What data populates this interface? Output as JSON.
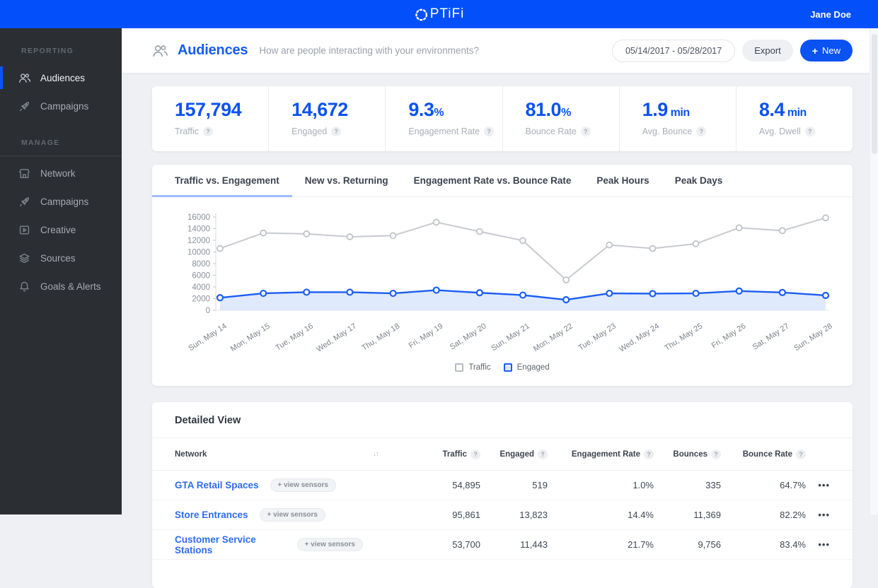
{
  "topbar": {
    "logo_text": "PTiFi",
    "user": "Jane Doe"
  },
  "sidebar": {
    "sections": [
      {
        "label": "REPORTING",
        "items": [
          {
            "label": "Audiences",
            "icon": "people-icon",
            "active": true
          },
          {
            "label": "Campaigns",
            "icon": "rocket-icon",
            "active": false
          }
        ]
      },
      {
        "label": "MANAGE",
        "items": [
          {
            "label": "Network",
            "icon": "storefront-icon",
            "active": false
          },
          {
            "label": "Campaigns",
            "icon": "rocket-icon",
            "active": false
          },
          {
            "label": "Creative",
            "icon": "media-icon",
            "active": false
          },
          {
            "label": "Sources",
            "icon": "layers-icon",
            "active": false
          },
          {
            "label": "Goals & Alerts",
            "icon": "bell-icon",
            "active": false
          }
        ]
      }
    ]
  },
  "header": {
    "title": "Audiences",
    "subtitle": "How are people interacting with your environments?",
    "date_range": "05/14/2017 - 05/28/2017",
    "export_label": "Export",
    "new_label": "New"
  },
  "stats": [
    {
      "value": "157,794",
      "unit": "",
      "label": "Traffic"
    },
    {
      "value": "14,672",
      "unit": "",
      "label": "Engaged"
    },
    {
      "value": "9.3",
      "unit": "%",
      "label": "Engagement Rate"
    },
    {
      "value": "81.0",
      "unit": "%",
      "label": "Bounce Rate"
    },
    {
      "value": "1.9",
      "unit": " min",
      "label": "Avg. Bounce"
    },
    {
      "value": "8.4",
      "unit": " min",
      "label": "Avg. Dwell"
    }
  ],
  "tabs": [
    {
      "label": "Traffic vs. Engagement",
      "active": true
    },
    {
      "label": "New vs. Returning",
      "active": false
    },
    {
      "label": "Engagement Rate vs. Bounce Rate",
      "active": false
    },
    {
      "label": "Peak Hours",
      "active": false
    },
    {
      "label": "Peak Days",
      "active": false
    }
  ],
  "chart_data": {
    "type": "line",
    "title": "Traffic vs. Engagement",
    "x": [
      "Sun, May 14",
      "Mon, May 15",
      "Tue, May 16",
      "Wed, May 17",
      "Thu, May 18",
      "Fri, May 19",
      "Sat, May 20",
      "Sun, May 21",
      "Mon, May 22",
      "Tue, May 23",
      "Wed, May 24",
      "Thu, May 25",
      "Fri, May 26",
      "Sat, May 27",
      "Sun, May 28"
    ],
    "series": [
      {
        "name": "Traffic",
        "color": "#c7cacf",
        "point_stroke": "#bfc3c9",
        "values": [
          10600,
          13250,
          13100,
          12600,
          12800,
          15100,
          13500,
          11950,
          5200,
          11200,
          10600,
          11400,
          14150,
          13650,
          15850
        ]
      },
      {
        "name": "Engaged",
        "color": "#1b5ef3",
        "fill": "#cbdcfb",
        "point_stroke": "#1b5ef3",
        "values": [
          2150,
          2900,
          3100,
          3100,
          2900,
          3450,
          3000,
          2600,
          1800,
          2900,
          2850,
          2900,
          3300,
          3050,
          2550
        ]
      }
    ],
    "ylim": [
      0,
      16000
    ],
    "yticks": [
      0,
      2000,
      4000,
      6000,
      8000,
      10000,
      12000,
      14000,
      16000
    ],
    "grid": false,
    "legend_position": "bottom"
  },
  "table": {
    "title": "Detailed View",
    "columns": [
      "Network",
      "Traffic",
      "Engaged",
      "Engagement Rate",
      "Bounces",
      "Bounce Rate"
    ],
    "rows": [
      {
        "network": "GTA Retail Spaces",
        "sensors_label": "+ view sensors",
        "traffic": "54,895",
        "engaged": "519",
        "engagement_rate": "1.0%",
        "bounces": "335",
        "bounce_rate": "64.7%"
      },
      {
        "network": "Store Entrances",
        "sensors_label": "+ view sensors",
        "traffic": "95,861",
        "engaged": "13,823",
        "engagement_rate": "14.4%",
        "bounces": "11,369",
        "bounce_rate": "82.2%"
      },
      {
        "network": "Customer Service Stations",
        "sensors_label": "+ view sensors",
        "traffic": "53,700",
        "engaged": "11,443",
        "engagement_rate": "21.7%",
        "bounces": "9,756",
        "bounce_rate": "83.4%"
      }
    ]
  }
}
